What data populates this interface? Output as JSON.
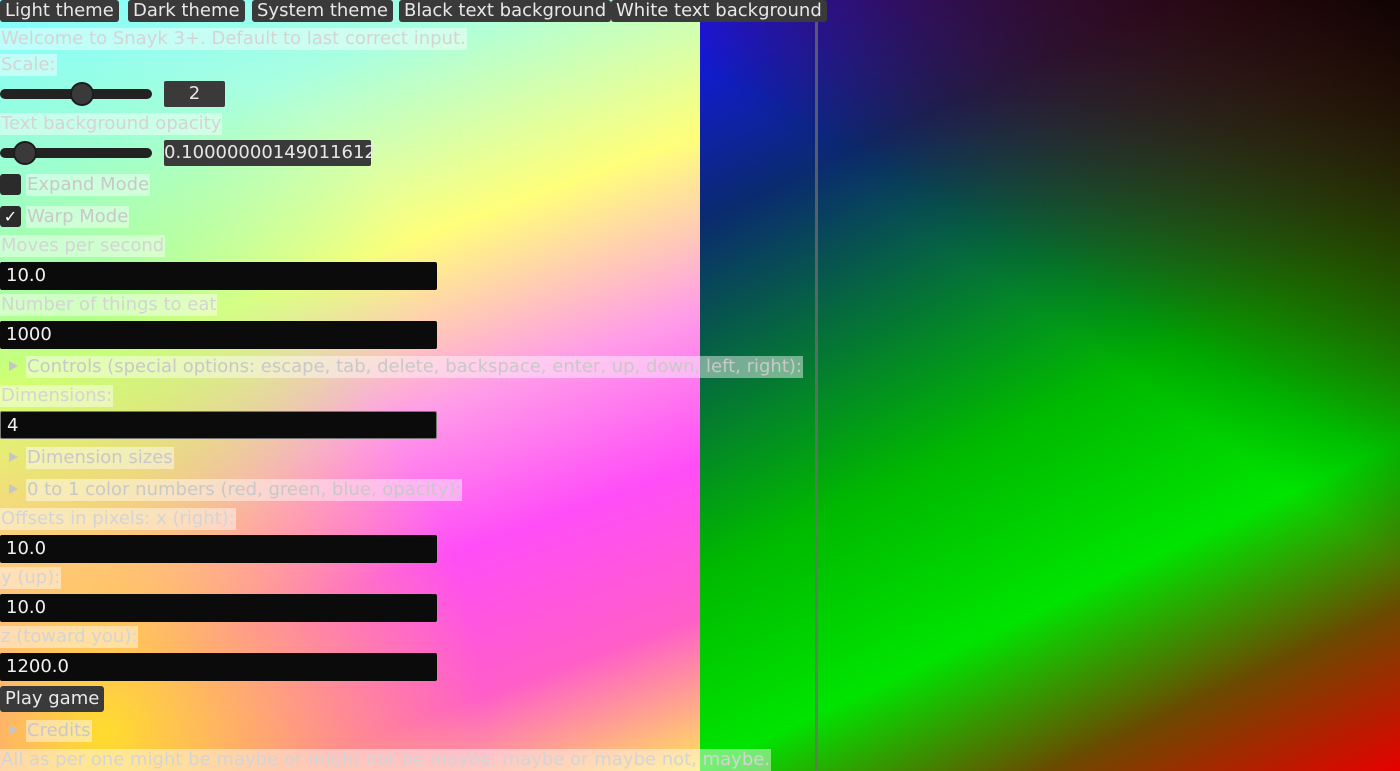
{
  "theme_buttons": [
    "Light theme",
    "Dark theme",
    "System theme",
    "Black text background",
    "White text background"
  ],
  "welcome": "Welcome to Snayk 3+. Default to last correct input.",
  "scale": {
    "label": "Scale:",
    "value": "2",
    "level": 0.55
  },
  "opacity": {
    "label": "Text background opacity",
    "value": "0.10000000149011612",
    "level": 0.1
  },
  "expand_mode": {
    "label": "Expand Mode",
    "checked": false
  },
  "warp_mode": {
    "label": "Warp Mode",
    "checked": true,
    "check_glyph": "✓"
  },
  "moves_per_second": {
    "label": "Moves per second",
    "value": "10.0"
  },
  "things_to_eat": {
    "label": "Number of things to eat",
    "value": "1000"
  },
  "controls": {
    "label": "Controls (special options: escape, tab, delete, backspace, enter, up, down, left, right):"
  },
  "dimensions": {
    "label": "Dimensions:",
    "value": "4"
  },
  "dimension_sizes": {
    "label": "Dimension sizes"
  },
  "color_numbers": {
    "label": "0 to 1 color numbers (red, green, blue, opacity):"
  },
  "offsets": {
    "x": {
      "label": "Offsets in pixels: x (right):",
      "value": "10.0"
    },
    "y": {
      "label": "y (up):",
      "value": "10.0"
    },
    "z": {
      "label": "z (toward you):",
      "value": "1200.0"
    }
  },
  "play_button": "Play game",
  "credits": {
    "label": "Credits"
  },
  "footer": "All as per one might be maybe or might not be maybe, maybe or maybe not, maybe."
}
